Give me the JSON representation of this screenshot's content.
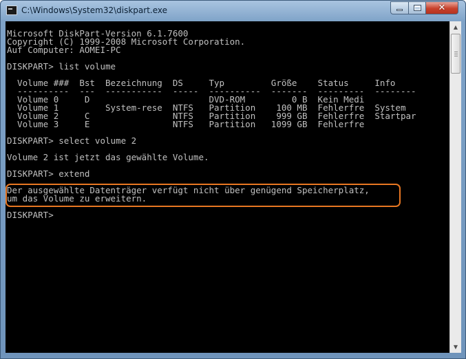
{
  "window": {
    "title": "C:\\Windows\\System32\\diskpart.exe",
    "close_symbol": "✕"
  },
  "console": {
    "lines": [
      "Microsoft DiskPart-Version 6.1.7600",
      "Copyright (C) 1999-2008 Microsoft Corporation.",
      "Auf Computer: AOMEI-PC",
      "",
      "DISKPART> list volume",
      "",
      "  Volume ###  Bst  Bezeichnung  DS     Typ         Größe    Status     Info",
      "  ----------  ---  -----------  -----  ----------  -------  ---------  --------",
      "  Volume 0     D                       DVD-ROM         0 B  Kein Medi",
      "  Volume 1         System-rese  NTFS   Partition    100 MB  Fehlerfre  System",
      "  Volume 2     C                NTFS   Partition    999 GB  Fehlerfre  Startpar",
      "  Volume 3     E                NTFS   Partition   1099 GB  Fehlerfre",
      "",
      "DISKPART> select volume 2",
      "",
      "Volume 2 ist jetzt das gewählte Volume.",
      "",
      "DISKPART> extend",
      "",
      "Der ausgewählte Datenträger verfügt nicht über genügend Speicherplatz,",
      "um das Volume zu erweitern.",
      "",
      "DISKPART> "
    ],
    "text_color": "#c0c0c0",
    "background_color": "#000000",
    "highlight_color": "#e87722"
  },
  "scrollbar": {
    "up_arrow": "▲",
    "down_arrow": "▼"
  }
}
